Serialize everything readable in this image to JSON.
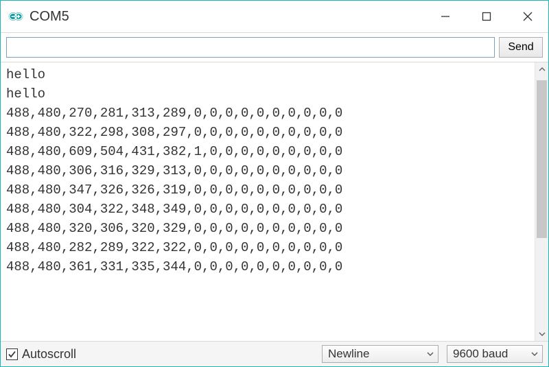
{
  "window": {
    "title": "COM5"
  },
  "toolbar": {
    "send_label": "Send",
    "input_value": ""
  },
  "output": {
    "lines": [
      "hello",
      "hello",
      "488,480,270,281,313,289,0,0,0,0,0,0,0,0,0,0",
      "488,480,322,298,308,297,0,0,0,0,0,0,0,0,0,0",
      "488,480,609,504,431,382,1,0,0,0,0,0,0,0,0,0",
      "488,480,306,316,329,313,0,0,0,0,0,0,0,0,0,0",
      "488,480,347,326,326,319,0,0,0,0,0,0,0,0,0,0",
      "488,480,304,322,348,349,0,0,0,0,0,0,0,0,0,0",
      "488,480,320,306,320,329,0,0,0,0,0,0,0,0,0,0",
      "488,480,282,289,322,322,0,0,0,0,0,0,0,0,0,0",
      "488,480,361,331,335,344,0,0,0,0,0,0,0,0,0,0"
    ]
  },
  "footer": {
    "autoscroll_label": "Autoscroll",
    "autoscroll_checked": true,
    "line_ending_selected": "Newline",
    "baud_selected": "9600 baud"
  },
  "colors": {
    "accent": "#00979d",
    "window_border": "#1cb5b5"
  }
}
